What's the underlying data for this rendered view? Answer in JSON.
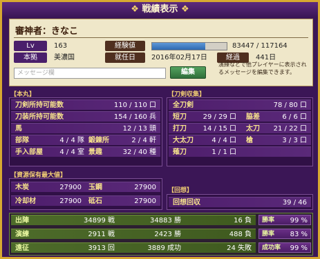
{
  "title": "戦績表示",
  "profile": {
    "name_label": "審神者：きなこ",
    "lv_label": "Lv",
    "lv_value": "163",
    "exp_label": "経験値",
    "exp_value": "83447 / 117164",
    "exp_fraction": 0.712,
    "home_label": "本拠",
    "home_value": "美濃国",
    "start_label": "就任日",
    "start_value": "2016年02月17日",
    "elapsed_label": "経過",
    "elapsed_value": "441日",
    "message_placeholder": "メッセージ欄",
    "edit_button": "編集",
    "note": "演練などで他プレイヤーに表示されるメッセージを編集できます。"
  },
  "honmaru": {
    "header": "【本丸】",
    "rows": [
      {
        "label": "刀剣所持可能数",
        "value": "110 / 110 口"
      },
      {
        "label": "刀装所持可能数",
        "value": "154 / 160 兵"
      },
      {
        "label": "馬",
        "value": "12 / 13 頭"
      }
    ],
    "pairs": [
      {
        "l1": "部隊",
        "v1": "4 / 4 隊",
        "l2": "鍛錬所",
        "v2": "2 / 4 軒"
      },
      {
        "l1": "手入部屋",
        "v1": "4 / 4 室",
        "l2": "景趣",
        "v2": "32 / 40 種"
      }
    ]
  },
  "collection": {
    "header": "【刀剣収集】",
    "total_label": "全刀剣",
    "total_value": "78 / 80 口",
    "cells": [
      {
        "label": "短刀",
        "value": "29 / 29 口"
      },
      {
        "label": "脇差",
        "value": "6 / 6 口"
      },
      {
        "label": "打刀",
        "value": "14 / 15 口"
      },
      {
        "label": "太刀",
        "value": "21 / 22 口"
      },
      {
        "label": "大太刀",
        "value": "4 / 4 口"
      },
      {
        "label": "槍",
        "value": "3 / 3 口"
      },
      {
        "label": "薙刀",
        "value": "1 / 1 口"
      }
    ]
  },
  "resources": {
    "header": "【資源保有最大値】",
    "cells": [
      {
        "label": "木炭",
        "value": "27900"
      },
      {
        "label": "玉鋼",
        "value": "27900"
      },
      {
        "label": "冷却材",
        "value": "27900"
      },
      {
        "label": "砥石",
        "value": "27900"
      }
    ]
  },
  "recall": {
    "header": "【回想】",
    "label": "回想回収",
    "value": "39 / 46"
  },
  "records": [
    {
      "label": "出陣",
      "a": "34899 戦",
      "b": "34883 勝",
      "c": "16 負",
      "rate_label": "勝率",
      "rate": "99 %"
    },
    {
      "label": "演練",
      "a": "2911 戦",
      "b": "2423 勝",
      "c": "488 負",
      "rate_label": "勝率",
      "rate": "83 %"
    },
    {
      "label": "遠征",
      "a": "3913 回",
      "b": "3889 成功",
      "c": "24 失敗",
      "rate_label": "成功率",
      "rate": "99 %"
    }
  ],
  "colors": {
    "gold": "#d7a931",
    "purple": "#3b1656",
    "green": "#4d6b2a"
  }
}
